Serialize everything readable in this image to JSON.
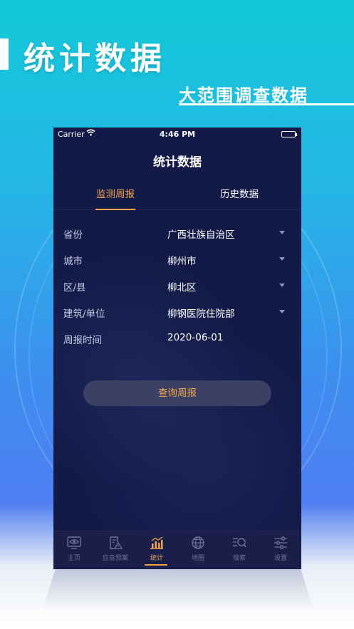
{
  "promo": {
    "title": "统计数据",
    "subtitle": "大范围调查数据"
  },
  "status_bar": {
    "carrier": "Carrier",
    "time": "4:46 PM"
  },
  "nav": {
    "title": "统计数据"
  },
  "tabs": [
    {
      "label": "监测周报",
      "active": true
    },
    {
      "label": "历史数据",
      "active": false
    }
  ],
  "form": {
    "rows": [
      {
        "label": "省份",
        "value": "广西壮族自治区",
        "dropdown": true
      },
      {
        "label": "城市",
        "value": "柳州市",
        "dropdown": true
      },
      {
        "label": "区/县",
        "value": "柳北区",
        "dropdown": true
      },
      {
        "label": "建筑/单位",
        "value": "柳钢医院住院部",
        "dropdown": true
      },
      {
        "label": "周报时间",
        "value": "2020-06-01",
        "dropdown": false
      }
    ],
    "query_label": "查询周报"
  },
  "tabbar": {
    "items": [
      {
        "label": "主页",
        "icon": "eye-monitor-icon",
        "active": false
      },
      {
        "label": "应急预案",
        "icon": "warning-document-icon",
        "active": false
      },
      {
        "label": "统计",
        "icon": "bar-chart-icon",
        "active": true
      },
      {
        "label": "地图",
        "icon": "globe-icon",
        "active": false
      },
      {
        "label": "搜索",
        "icon": "search-list-icon",
        "active": false
      },
      {
        "label": "设置",
        "icon": "sliders-icon",
        "active": false
      }
    ]
  },
  "colors": {
    "accent": "#f1a44a",
    "phone_bg": "#131a48",
    "tabbar_bg": "#1a1f4a",
    "inactive_icon": "#6d7397"
  }
}
